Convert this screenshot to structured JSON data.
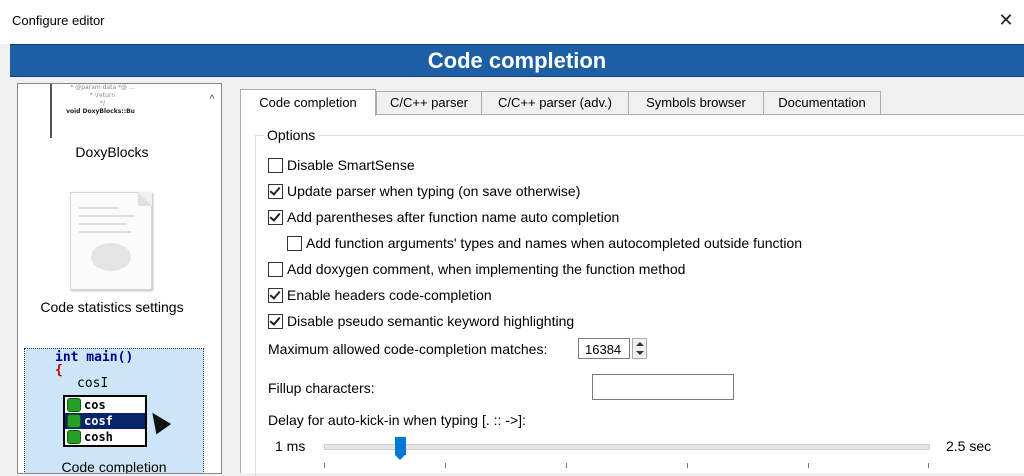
{
  "window": {
    "title": "Configure editor",
    "close_glyph": "✕"
  },
  "banner": {
    "title": "Code completion"
  },
  "sidebar": {
    "items": [
      {
        "label": "DoxyBlocks",
        "thumb_lines": [
          "* @param data *@ ...",
          "* \\return",
          "",
          "*/",
          "void DoxyBlocks::Bu"
        ]
      },
      {
        "label": "Code statistics settings"
      },
      {
        "label": "Code completion",
        "selected": true,
        "preview": {
          "line1_kw": "int",
          "line1_rest": " main()",
          "brace": "{",
          "typed": "cos",
          "suggestions": [
            "cos",
            "cosf",
            "cosh"
          ],
          "selected_suggestion": "cosf"
        }
      }
    ],
    "scroll_up_glyph": "^"
  },
  "tabs": [
    {
      "label": "Code completion",
      "active": true
    },
    {
      "label": "C/C++ parser",
      "active": false
    },
    {
      "label": "C/C++ parser (adv.)",
      "active": false
    },
    {
      "label": "Symbols browser",
      "active": false
    },
    {
      "label": "Documentation",
      "active": false
    }
  ],
  "options": {
    "group_title": "Options",
    "checkboxes": [
      {
        "label": "Disable SmartSense",
        "checked": false
      },
      {
        "label": "Update parser when typing (on save otherwise)",
        "checked": true
      },
      {
        "label": "Add parentheses after function name auto completion",
        "checked": true
      },
      {
        "label": "Add function arguments' types and names when autocompleted outside function",
        "checked": false
      },
      {
        "label": "Add doxygen comment, when implementing the function method",
        "checked": false
      },
      {
        "label": "Enable headers code-completion",
        "checked": true
      },
      {
        "label": "Disable pseudo semantic keyword highlighting",
        "checked": true
      }
    ],
    "max_matches_label": "Maximum allowed code-completion matches:",
    "max_matches_value": "16384",
    "fillup_label": "Fillup characters:",
    "fillup_value": "",
    "delay_label": "Delay for auto-kick-in when typing [. :: ->]:",
    "delay_min_label": "1 ms",
    "delay_max_label": "2.5 sec",
    "delay_level_fraction": 0.12
  },
  "colors": {
    "banner": "#1c5fa5",
    "selection": "#cde6f7",
    "slider": "#0078d7"
  }
}
